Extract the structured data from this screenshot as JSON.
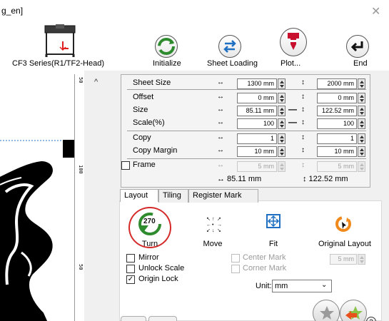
{
  "window": {
    "title": "g_en]"
  },
  "toolbar": {
    "device_label": "CF3 Series(R1/TF2-Head)",
    "initialize_label": "Initialize",
    "sheet_loading_label": "Sheet Loading",
    "plot_label": "Plot...",
    "end_label": "End"
  },
  "ruler": {
    "top_text": "50",
    "mid_text": "100",
    "low_text": "50"
  },
  "params": {
    "sheet_size": {
      "label": "Sheet Size",
      "w": "1300 mm",
      "h": "2000 mm"
    },
    "offset": {
      "label": "Offset",
      "w": "0 mm",
      "h": "0 mm"
    },
    "size": {
      "label": "Size",
      "w": "85.11 mm",
      "h": "122.52 mm"
    },
    "scale": {
      "label": "Scale(%)",
      "w": "100",
      "h": "100"
    },
    "copy": {
      "label": "Copy",
      "w": "1",
      "h": "1"
    },
    "copy_margin": {
      "label": "Copy Margin",
      "w": "10 mm",
      "h": "10 mm"
    },
    "frame": {
      "label": "Frame",
      "w": "5 mm",
      "h": "5 mm"
    },
    "total": {
      "w": "↔ 85.11 mm",
      "h": "↕ 122.52 mm"
    }
  },
  "tabs": [
    "Layout",
    "Tiling",
    "Register Mark"
  ],
  "layout": {
    "turn_value": "270",
    "turn_label": "Turn",
    "move_label": "Move",
    "fit_label": "Fit",
    "original_layout_label": "Original Layout",
    "mirror_label": "Mirror",
    "unlock_scale_label": "Unlock Scale",
    "origin_lock_label": "Origin Lock",
    "center_mark_label": "Center Mark",
    "corner_mark_label": "Corner Mark",
    "mark_value": "5 mm",
    "unit_label": "Unit:",
    "unit_value": "mm"
  },
  "colors": {
    "accent_blue": "#1f6fc2",
    "green": "#2e8b2e",
    "red_circle": "#d42a2a",
    "plot_red": "#c8102e",
    "orange": "#f08a1c"
  }
}
